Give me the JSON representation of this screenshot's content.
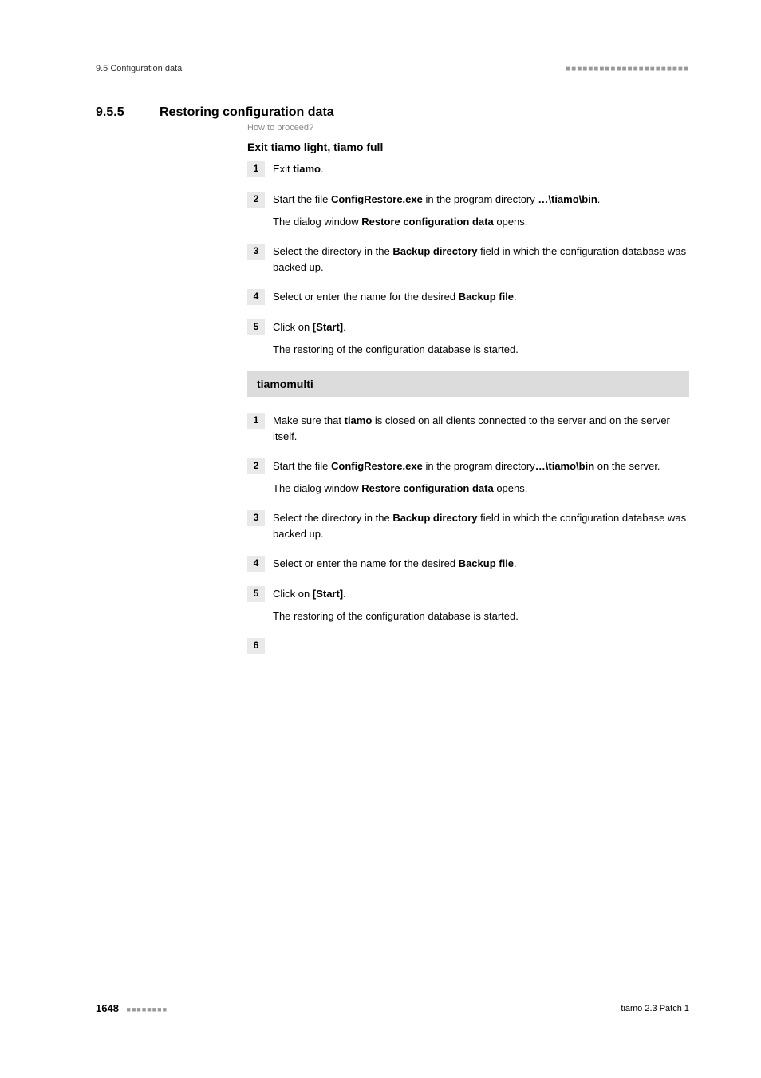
{
  "header": {
    "left": "9.5 Configuration data",
    "dots": "■■■■■■■■■■■■■■■■■■■■■■"
  },
  "section": {
    "number": "9.5.5",
    "title": "Restoring configuration data",
    "howto": "How to proceed?"
  },
  "block1": {
    "heading": "Exit tiamo light, tiamo full",
    "steps": {
      "s1": {
        "num": "1",
        "a_pre": "Exit ",
        "a_bold": "tiamo",
        "a_post": "."
      },
      "s2": {
        "num": "2",
        "a_pre": "Start the file ",
        "a_b1": "ConfigRestore.exe",
        "a_mid": " in the program directory ",
        "a_b2": "…\\tiamo\\bin",
        "a_post": ".",
        "b_pre": "The dialog window ",
        "b_b": "Restore configuration data",
        "b_post": " opens."
      },
      "s3": {
        "num": "3",
        "a_pre": "Select the directory in the ",
        "a_b": "Backup directory",
        "a_post": " field in which the configuration database was backed up."
      },
      "s4": {
        "num": "4",
        "a_pre": "Select or enter the name for the desired ",
        "a_b": "Backup file",
        "a_post": "."
      },
      "s5": {
        "num": "5",
        "a_pre": "Click on ",
        "a_b": "[Start]",
        "a_post": ".",
        "b": "The restoring of the configuration database is started."
      }
    }
  },
  "block2": {
    "heading": "tiamomulti",
    "steps": {
      "s1": {
        "num": "1",
        "a_pre": "Make sure that ",
        "a_b": "tiamo",
        "a_post": " is closed on all clients connected to the server and on the server itself."
      },
      "s2": {
        "num": "2",
        "a_pre": "Start the file ",
        "a_b1": "ConfigRestore.exe",
        "a_mid": " in the program directory",
        "a_b2": "…\\tiamo\\bin",
        "a_post": " on the server.",
        "b_pre": "The dialog window ",
        "b_b": "Restore configuration data",
        "b_post": " opens."
      },
      "s3": {
        "num": "3",
        "a_pre": "Select the directory in the ",
        "a_b": "Backup directory",
        "a_post": " field in which the configuration database was backed up."
      },
      "s4": {
        "num": "4",
        "a_pre": "Select or enter the name for the desired ",
        "a_b": "Backup file",
        "a_post": "."
      },
      "s5": {
        "num": "5",
        "a_pre": "Click on ",
        "a_b": "[Start]",
        "a_post": ".",
        "b": "The restoring of the configuration database is started."
      },
      "s6": {
        "num": "6"
      }
    }
  },
  "footer": {
    "page": "1648",
    "dots": "■■■■■■■■",
    "right": "tiamo 2.3 Patch 1"
  }
}
